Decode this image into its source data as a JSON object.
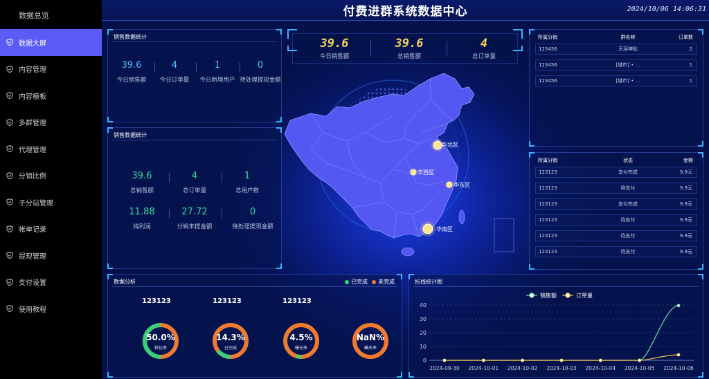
{
  "sidebar": {
    "top": "数据总览",
    "items": [
      {
        "label": "数据大屏",
        "active": true
      },
      {
        "label": "内容管理"
      },
      {
        "label": "内容模板"
      },
      {
        "label": "多群管理"
      },
      {
        "label": "代理管理"
      },
      {
        "label": "分销比例"
      },
      {
        "label": "子分站管理"
      },
      {
        "label": "帐单记录"
      },
      {
        "label": "提现管理"
      },
      {
        "label": "支付设置"
      },
      {
        "label": "使用教程"
      }
    ]
  },
  "header": {
    "title": "付费进群系统数据中心",
    "clock": "2024/10/06 14:06:31"
  },
  "panel1": {
    "title": "销售数据统计",
    "stats": [
      {
        "value": "39.6",
        "label": "今日销售额"
      },
      {
        "value": "4",
        "label": "今日订单量"
      },
      {
        "value": "1",
        "label": "今日新增用户"
      },
      {
        "value": "0",
        "label": "待处理提现金额"
      }
    ]
  },
  "panel2": {
    "title": "销售数据统计",
    "stats": [
      {
        "value": "39.6",
        "label": "总销售额"
      },
      {
        "value": "4",
        "label": "总订单量"
      },
      {
        "value": "1",
        "label": "总用户数"
      },
      {
        "value": "11.88",
        "label": "纯利润"
      },
      {
        "value": "27.72",
        "label": "分销未提金额"
      },
      {
        "value": "0",
        "label": "待处理提现金额"
      }
    ]
  },
  "topstats": [
    {
      "value": "39.6",
      "label": "今日销售额"
    },
    {
      "value": "39.6",
      "label": "总销售额"
    },
    {
      "value": "4",
      "label": "总订单量"
    }
  ],
  "map": {
    "regions": [
      "华北区",
      "华西区",
      "华东区",
      "华南区"
    ]
  },
  "table1": {
    "headers": [
      "所属分销",
      "群名称",
      "订单数"
    ],
    "rows": [
      [
        "123456",
        "天涯神贴",
        "2"
      ],
      [
        "123456",
        "[城市] • ...",
        "1"
      ],
      [
        "123456",
        "[城市] • ...",
        "1"
      ]
    ]
  },
  "table2": {
    "headers": [
      "所属分销",
      "状态",
      "金额"
    ],
    "rows": [
      [
        "123123",
        "支付完成",
        "9.9元"
      ],
      [
        "123123",
        "待支付",
        "9.9元"
      ],
      [
        "123123",
        "支付完成",
        "9.9元"
      ],
      [
        "123123",
        "待支付",
        "9.9元"
      ],
      [
        "123123",
        "待支付",
        "9.9元"
      ],
      [
        "123123",
        "待支付",
        "9.9元"
      ]
    ]
  },
  "analysis": {
    "title": "数据分析",
    "legend": [
      {
        "label": "已完成",
        "color": "#3ad07a"
      },
      {
        "label": "未完成",
        "color": "#f07b2e"
      }
    ],
    "counts": [
      "123123",
      "123123",
      "123123"
    ],
    "rings": [
      {
        "pct": "50.0%",
        "label": "转化率",
        "value": 0.5
      },
      {
        "pct": "14.3%",
        "label": "已完成",
        "value": 0.143
      },
      {
        "pct": "4.5%",
        "label": "曝光率",
        "value": 0.045
      },
      {
        "pct": "NaN%",
        "label": "曝光率",
        "value": 0
      }
    ]
  },
  "linechart": {
    "title": "折线统计图"
  },
  "chart_data": {
    "type": "line",
    "categories": [
      "2024-09-30",
      "2024-10-01",
      "2024-10-02",
      "2024-10-03",
      "2024-10-04",
      "2024-10-05",
      "2024-10-06"
    ],
    "series": [
      {
        "name": "销售额",
        "values": [
          0,
          0,
          0,
          0,
          0,
          0,
          39.6
        ],
        "color": "#6fe3a3"
      },
      {
        "name": "订单量",
        "values": [
          0,
          0,
          0,
          0,
          0,
          0,
          4
        ],
        "color": "#f5c842"
      }
    ],
    "yticks": [
      0,
      10,
      20,
      30,
      40
    ],
    "ylim": [
      0,
      40
    ],
    "legend": "top-center",
    "grid": true
  }
}
